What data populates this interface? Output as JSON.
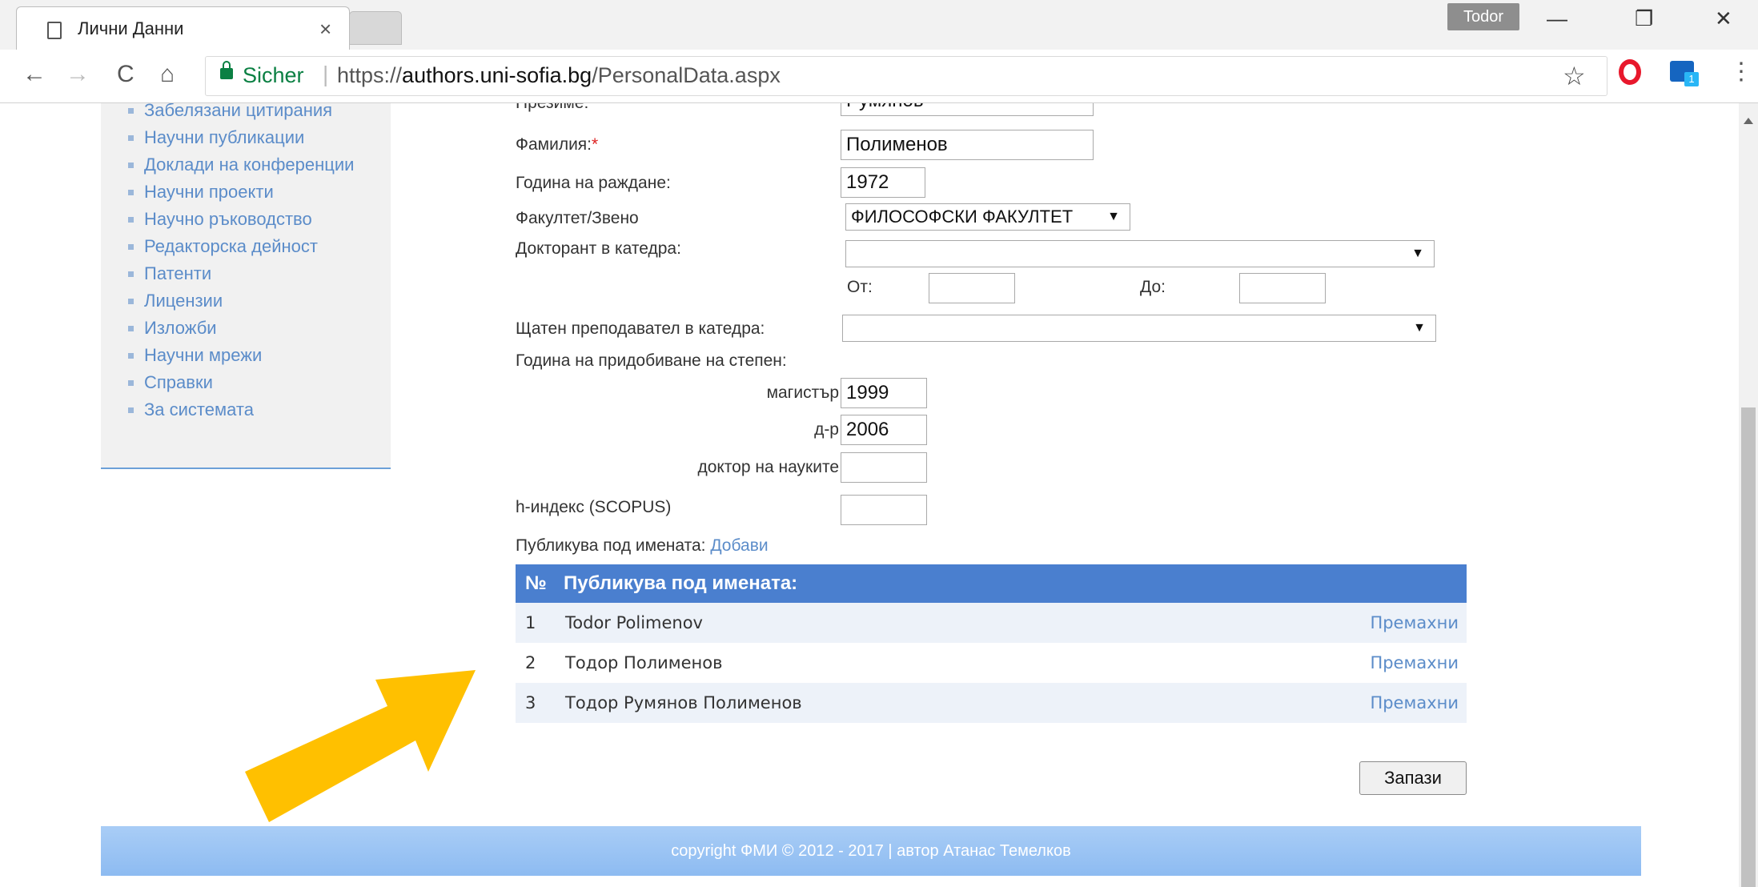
{
  "browser": {
    "tab_title": "Лични Данни",
    "tab_close": "×",
    "profile_name": "Todor",
    "window": {
      "minimize": "—",
      "restore": "❐",
      "close": "✕"
    },
    "nav": {
      "back": "←",
      "forward": "→",
      "reload": "C",
      "home": "⌂"
    },
    "security_label": "Sicher",
    "url_scheme": "https://",
    "url_host": "authors.uni-sofia.bg",
    "url_path": "/PersonalData.aspx",
    "bookmark_star": "☆",
    "ext_badge": "1",
    "menu": "⋮"
  },
  "sidebar": {
    "items": [
      {
        "label": "Забелязани цитирания"
      },
      {
        "label": "Научни публикации"
      },
      {
        "label": "Доклади на конференции"
      },
      {
        "label": "Научни проекти"
      },
      {
        "label": "Научно ръководство"
      },
      {
        "label": "Редакторска дейност"
      },
      {
        "label": "Патенти"
      },
      {
        "label": "Лицензии"
      },
      {
        "label": "Изложби"
      },
      {
        "label": "Научни мрежи"
      },
      {
        "label": "Справки"
      },
      {
        "label": "За системата"
      }
    ]
  },
  "form": {
    "middle_name_label": "Презиме:",
    "middle_name_value": "Румянов",
    "last_name_label": "Фамилия:",
    "required_mark": "*",
    "last_name_value": "Полименов",
    "birth_year_label": "Година на раждане:",
    "birth_year_value": "1972",
    "faculty_label": "Факултет/Звено",
    "faculty_value": "ФИЛОСОФСКИ ФАКУЛТЕТ",
    "doctorant_label": "Докторант в катедра:",
    "doctorant_value": "",
    "from_label": "От:",
    "from_value": "",
    "to_label": "До:",
    "to_value": "",
    "staff_label": "Щатен преподавател в катедра:",
    "staff_value": "",
    "degree_year_label": "Година на придобиване на степен:",
    "master_label": "магистър",
    "master_value": "1999",
    "phd_label": "д-р",
    "phd_value": "2006",
    "dsc_label": "доктор на науките",
    "dsc_value": "",
    "hindex_label": "h-индекс (SCOPUS)",
    "hindex_value": "",
    "publishes_label": "Публикува под имената:",
    "add_link": "Добави"
  },
  "names_table": {
    "col_num": "№",
    "col_name": "Публикува под имената:",
    "remove_label": "Премахни",
    "rows": [
      {
        "num": "1",
        "name": "Todor Polimenov"
      },
      {
        "num": "2",
        "name": "Тодор Полименов"
      },
      {
        "num": "3",
        "name": "Тодор Румянов Полименов"
      }
    ]
  },
  "save_button": "Запази",
  "footer": "copyright ФМИ © 2012 - 2017 | автор Атанас Темелков",
  "colors": {
    "accent": "#4a7fcf",
    "link": "#5b8cc9",
    "arrow": "#ffc000"
  }
}
